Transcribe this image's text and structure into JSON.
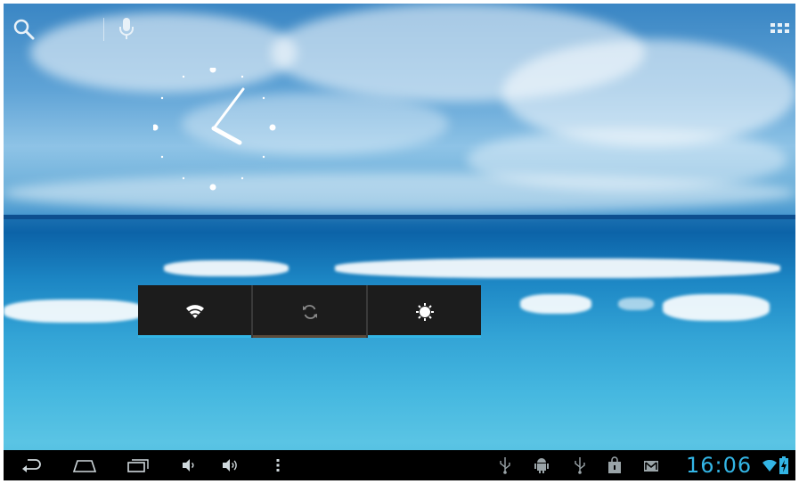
{
  "status_bar": {
    "time": "16:06"
  },
  "colors": {
    "accent": "#33b5e5",
    "navbar": "#000000",
    "widget_bg": "#1c1c1c"
  },
  "home": {
    "search_icon": "search-icon",
    "voice_icon": "mic-icon",
    "apps_icon": "apps-grid-icon"
  },
  "power_widget": {
    "toggles": [
      {
        "icon": "wifi-icon",
        "state": "on"
      },
      {
        "icon": "sync-icon",
        "state": "off"
      },
      {
        "icon": "brightness-icon",
        "state": "on"
      }
    ]
  },
  "navigation": {
    "buttons": [
      "back-icon",
      "home-icon",
      "recent-apps-icon",
      "volume-down-icon",
      "volume-up-icon",
      "menu-icon"
    ]
  },
  "notifications": [
    "usb-icon",
    "android-debug-icon",
    "usb-icon",
    "shopping-bag-icon",
    "gmail-icon"
  ]
}
